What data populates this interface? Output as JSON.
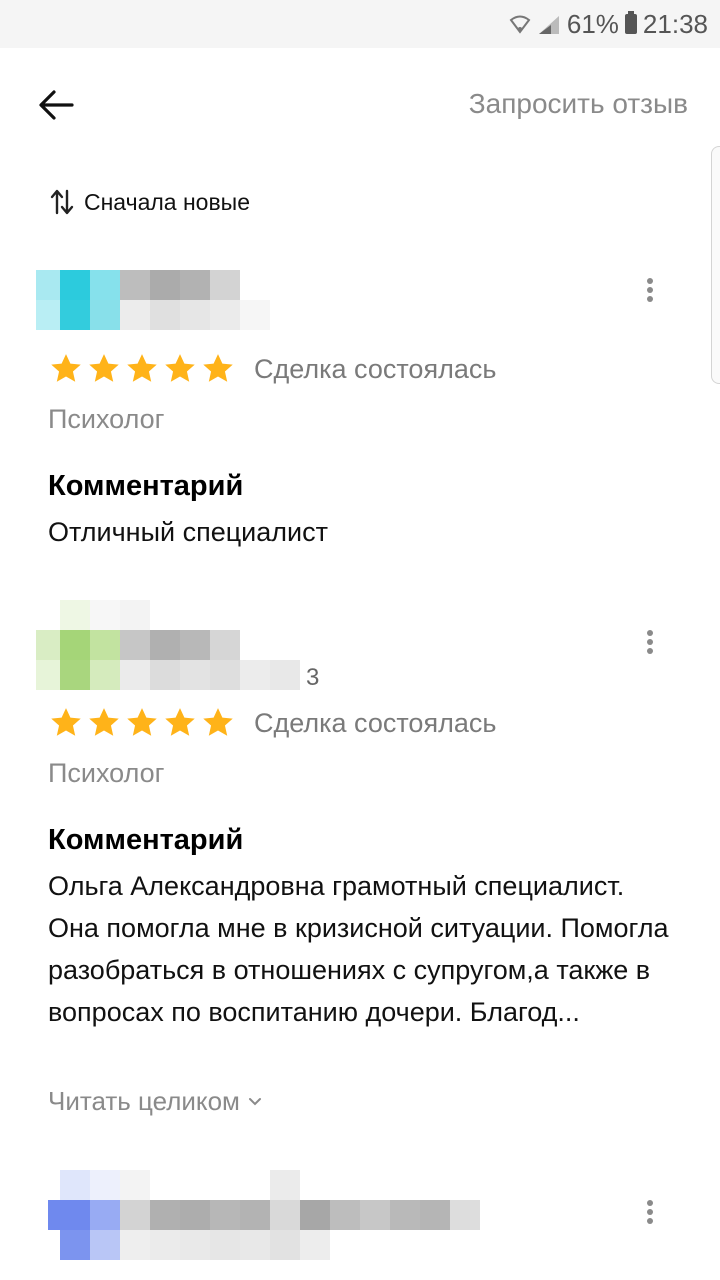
{
  "status_bar": {
    "battery": "61%",
    "time": "21:38",
    "icons": [
      "wifi-icon",
      "signal-icon",
      "battery-icon"
    ]
  },
  "header": {
    "back_icon": "arrow-left-icon",
    "request_review": "Запросить отзыв"
  },
  "sort": {
    "icon": "sort-arrows-icon",
    "label": "Сначала новые"
  },
  "colors": {
    "star": "#FFB319",
    "muted_text": "#8a8a8a",
    "avatar_cyan": "#29c7dc",
    "avatar_green": "#9ccf67",
    "avatar_blue": "#6d87ef"
  },
  "reviews": [
    {
      "author_name": "",
      "rating": 5,
      "deal_status": "Сделка состоялась",
      "category": "Психолог",
      "comment_heading": "Комментарий",
      "comment": "Отличный специалист"
    },
    {
      "author_name": "",
      "author_suffix": "3",
      "rating": 5,
      "deal_status": "Сделка состоялась",
      "category": "Психолог",
      "comment_heading": "Комментарий",
      "comment": "Ольга Александровна грамотный специалист. Она помогла мне в кризисной ситуации. Помогла разобраться в отношениях с супругом,а также в вопросах по воспитанию дочери. Благод...",
      "read_more": "Читать целиком"
    },
    {
      "author_name": "",
      "rating": null
    }
  ]
}
